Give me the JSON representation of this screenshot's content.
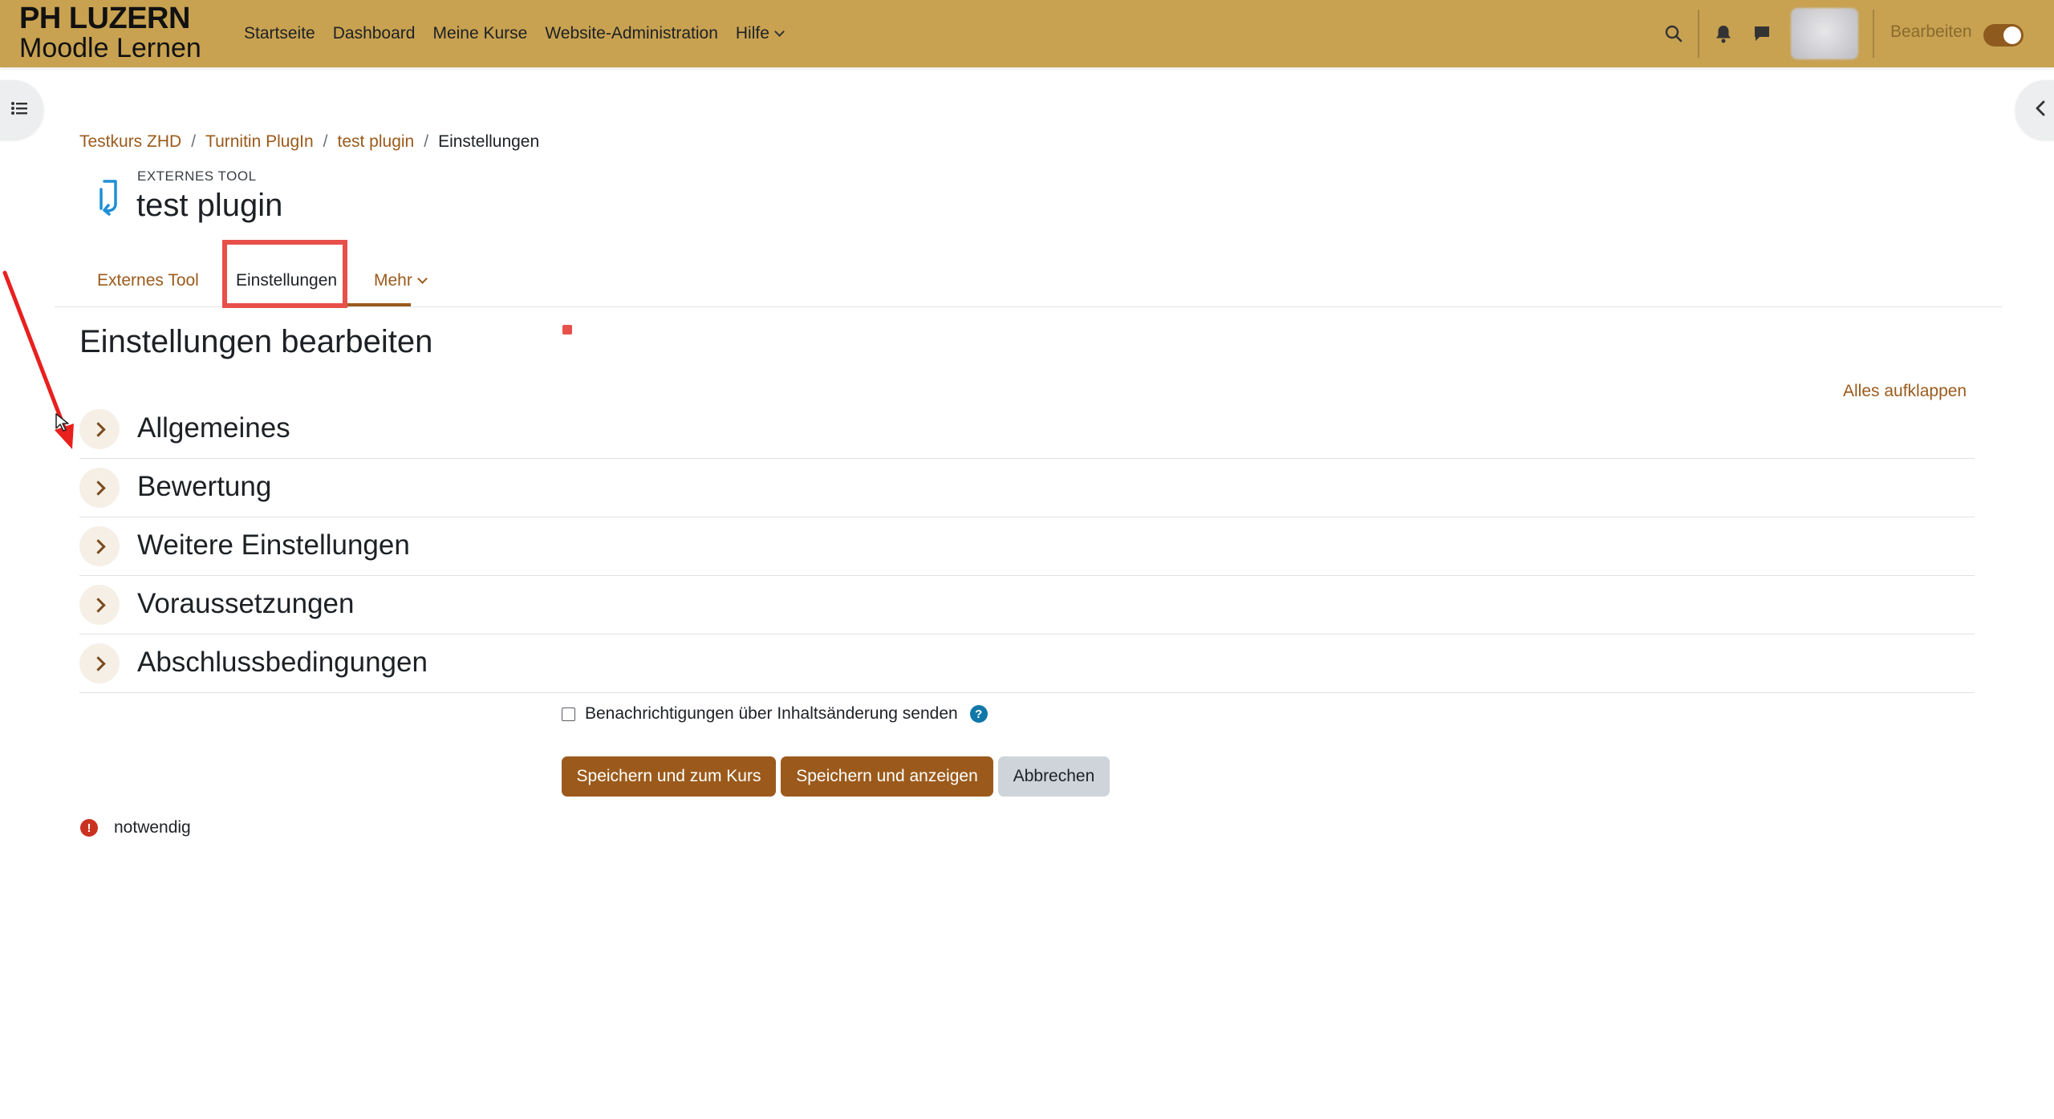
{
  "brand": {
    "line1": "PH LUZERN",
    "line2": "Moodle Lernen"
  },
  "nav": {
    "links": [
      "Startseite",
      "Dashboard",
      "Meine Kurse",
      "Website-Administration",
      "Hilfe"
    ]
  },
  "header_right": {
    "edit_label": "Bearbeiten",
    "edit_mode_on": true
  },
  "breadcrumb": [
    "Testkurs ZHD",
    "Turnitin PlugIn",
    "test plugin",
    "Einstellungen"
  ],
  "page": {
    "pretitle": "EXTERNES TOOL",
    "title": "test plugin"
  },
  "tabs": [
    "Externes Tool",
    "Einstellungen",
    "Mehr"
  ],
  "active_tab": "Einstellungen",
  "form": {
    "heading": "Einstellungen bearbeiten",
    "expand_all": "Alles aufklappen",
    "sections": [
      "Allgemeines",
      "Bewertung",
      "Weitere Einstellungen",
      "Voraussetzungen",
      "Abschlussbedingungen"
    ],
    "notify_label": "Benachrichtigungen über Inhaltsänderung senden",
    "notify_checked": false,
    "buttons": {
      "save_return": "Speichern und zum Kurs",
      "save_display": "Speichern und anzeigen",
      "cancel": "Abbrechen"
    },
    "required_label": "notwendig"
  },
  "colors": {
    "navbar": "#c8a251",
    "primary": "#9b5a1b",
    "annotation": "#e8504a"
  },
  "icons": [
    "search-icon",
    "bell-icon",
    "chat-icon",
    "list-icon",
    "chevron-left-icon",
    "external-tool-icon",
    "help-icon",
    "error-icon"
  ]
}
